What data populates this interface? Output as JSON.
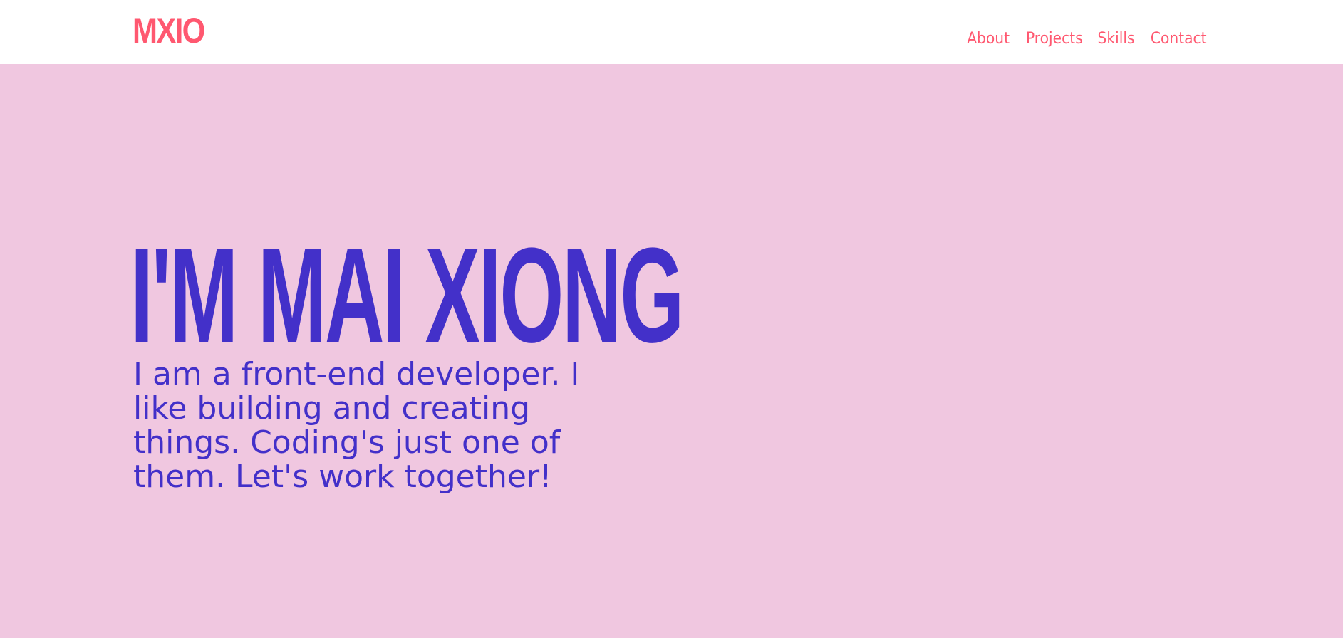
{
  "header": {
    "logo": "MXIO",
    "nav": [
      {
        "label": "About"
      },
      {
        "label": "Projects"
      },
      {
        "label": "Skills"
      },
      {
        "label": "Contact"
      }
    ]
  },
  "hero": {
    "title": "I'M MAI XIONG",
    "description": "I am a front-end developer. I like building and creating things. Coding's just one of them. Let's work together!"
  },
  "colors": {
    "accent": "#ff5870",
    "primary": "#4330c9",
    "background": "#f0c7e0",
    "header_background": "#ffffff"
  }
}
